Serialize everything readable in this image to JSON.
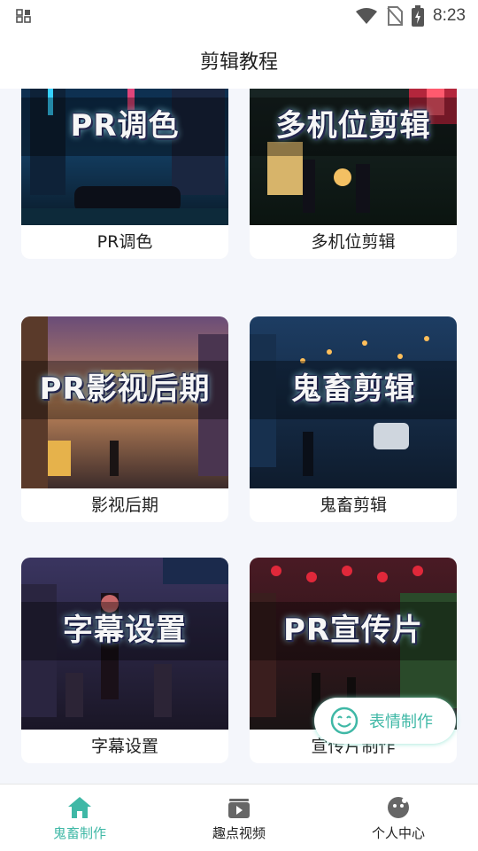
{
  "status_bar": {
    "time": "8:23"
  },
  "header": {
    "title": "剪辑教程"
  },
  "cards": [
    {
      "overlay": "PR调色",
      "label": "PR调色"
    },
    {
      "overlay": "多机位剪辑",
      "label": "多机位剪辑"
    },
    {
      "overlay": "PR影视后期",
      "label": "影视后期"
    },
    {
      "overlay": "鬼畜剪辑",
      "label": "鬼畜剪辑"
    },
    {
      "overlay": "字幕设置",
      "label": "字幕设置"
    },
    {
      "overlay": "PR宣传片",
      "label": "宣传片制作"
    }
  ],
  "fab": {
    "label": "表情制作"
  },
  "bottom_nav": [
    {
      "label": "鬼畜制作",
      "icon": "home-icon",
      "active": true
    },
    {
      "label": "趣点视频",
      "icon": "video-icon",
      "active": false
    },
    {
      "label": "个人中心",
      "icon": "profile-face-icon",
      "active": false
    }
  ],
  "colors": {
    "accent": "#3fb8a6",
    "background": "#f4f6fb"
  }
}
